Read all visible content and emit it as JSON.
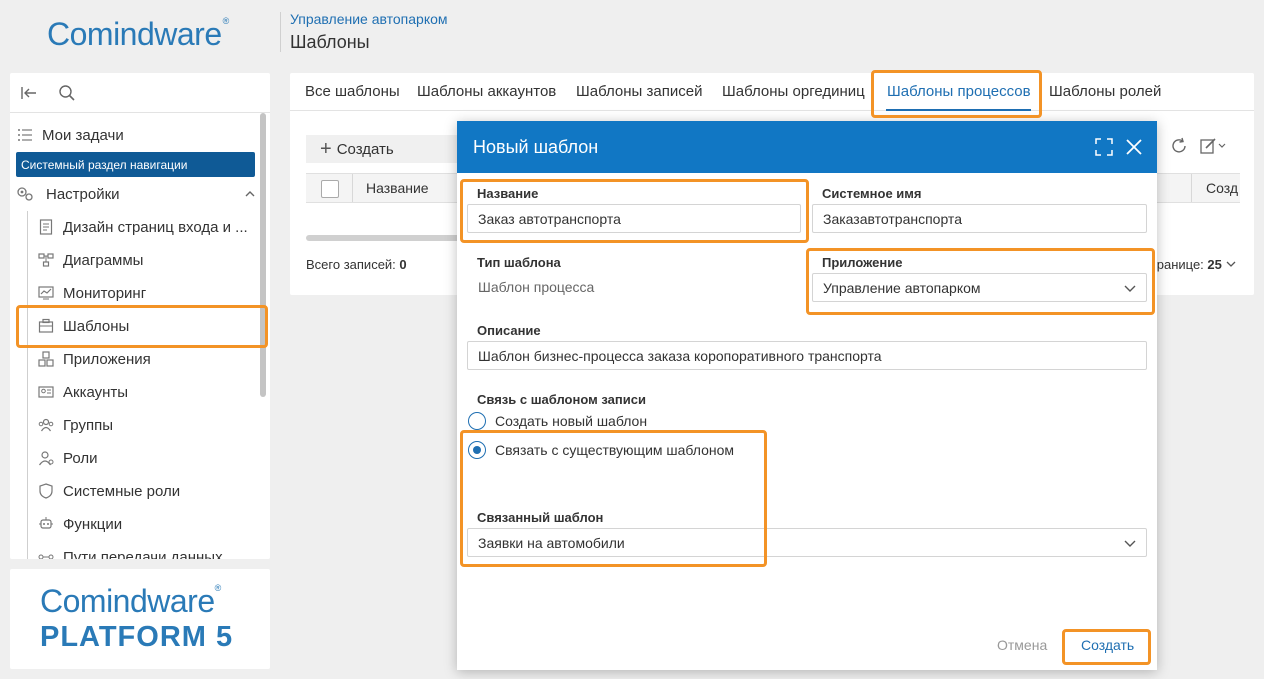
{
  "header": {
    "logo": "Comindware",
    "breadcrumb": "Управление автопарком",
    "title": "Шаблоны"
  },
  "sidebar": {
    "items": [
      {
        "label": "Мои задачи",
        "icon": "tasks-icon"
      },
      {
        "label": "Настройки",
        "icon": "settings-icon"
      },
      {
        "label": "Дизайн страниц входа и ...",
        "icon": "page-design-icon"
      },
      {
        "label": "Диаграммы",
        "icon": "diagram-icon"
      },
      {
        "label": "Мониторинг",
        "icon": "monitoring-icon"
      },
      {
        "label": "Шаблоны",
        "icon": "template-icon"
      },
      {
        "label": "Приложения",
        "icon": "apps-icon"
      },
      {
        "label": "Аккаунты",
        "icon": "account-icon"
      },
      {
        "label": "Группы",
        "icon": "groups-icon"
      },
      {
        "label": "Роли",
        "icon": "role-icon"
      },
      {
        "label": "Системные роли",
        "icon": "shield-icon"
      },
      {
        "label": "Функции",
        "icon": "functions-icon"
      },
      {
        "label": "Пути передачи данных",
        "icon": "data-path-icon"
      }
    ],
    "system_section": "Системный раздел навигации"
  },
  "logo_bottom": {
    "line1": "Comindware",
    "line2": "PLATFORM 5"
  },
  "tabs": [
    {
      "label": "Все шаблоны"
    },
    {
      "label": "Шаблоны аккаунтов"
    },
    {
      "label": "Шаблоны записей"
    },
    {
      "label": "Шаблоны оргединиц"
    },
    {
      "label": "Шаблоны процессов"
    },
    {
      "label": "Шаблоны ролей"
    }
  ],
  "active_tab": "Шаблоны процессов",
  "toolbar": {
    "create_label": "Создать"
  },
  "table": {
    "columns": [
      "Название",
      "Созд"
    ],
    "total_label": "Всего записей:",
    "total_value": "0",
    "per_page_label": "границе:",
    "per_page_value": "25"
  },
  "modal": {
    "title": "Новый шаблон",
    "name_label": "Название",
    "name_value": "Заказ автотранспорта",
    "sysname_label": "Системное имя",
    "sysname_value": "Заказавтотранспорта",
    "type_label": "Тип шаблона",
    "type_value": "Шаблон процесса",
    "app_label": "Приложение",
    "app_value": "Управление автопарком",
    "desc_label": "Описание",
    "desc_value": "Шаблон бизнес-процесса заказа коропоративного транспорта",
    "link_label": "Связь с шаблоном записи",
    "radio_new": "Создать новый шаблон",
    "radio_link": "Связать с существующим шаблоном",
    "linked_label": "Связанный шаблон",
    "linked_value": "Заявки на автомобили",
    "cancel": "Отмена",
    "create": "Создать"
  },
  "colors": {
    "accent": "#1177c4",
    "highlight": "#f39326",
    "nav_selected": "#0f5a96"
  }
}
